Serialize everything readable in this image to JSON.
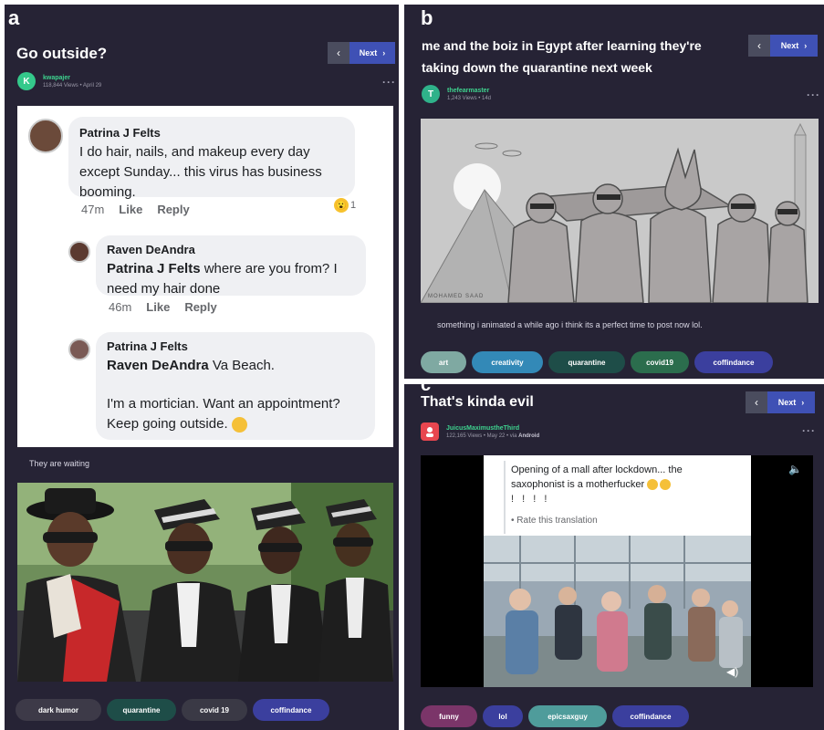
{
  "panels": {
    "a": {
      "letter": "a",
      "title": "Go outside?",
      "nav": {
        "prev": "‹",
        "next": "Next",
        "next_chevron": "›"
      },
      "author": {
        "avatar_letter": "K",
        "username": "kwapajer",
        "stats": "118,844 Views • April 29"
      },
      "more": "···",
      "comments": [
        {
          "name": "Patrina J Felts",
          "lines": [
            "I do hair, nails, and makeup every day",
            "except Sunday... this virus has business",
            "booming."
          ],
          "time": "47m",
          "like": "Like",
          "reply": "Reply",
          "reaction_count": "1"
        },
        {
          "name": "Raven DeAndra",
          "mention": "Patrina J Felts",
          "lines_after_mention": " where are you from? I",
          "line2": "need my hair done",
          "time": "46m",
          "like": "Like",
          "reply": "Reply"
        },
        {
          "name": "Patrina J Felts",
          "mention": "Raven DeAndra",
          "after_mention": " Va Beach.",
          "line2": "I'm a mortician. Want an appointment?",
          "line3": "Keep going outside."
        }
      ],
      "caption": "They are waiting",
      "tags": [
        "dark humor",
        "quarantine",
        "covid 19",
        "coffindance"
      ]
    },
    "b": {
      "letter": "b",
      "title_line1": "me and the boiz in Egypt after learning they're",
      "title_line2": "taking down the quarantine next week",
      "nav": {
        "prev": "‹",
        "next": "Next",
        "next_chevron": "›"
      },
      "author": {
        "avatar_letter": "T",
        "username": "thefearmaster",
        "stats": "1,243 Views • 14d"
      },
      "more": "···",
      "caption": "something i animated a while ago i think its a perfect time to post now lol.",
      "watermark": "MOHAMED SAAD",
      "tags": [
        "art",
        "creativity",
        "quarantine",
        "covid19",
        "coffindance"
      ]
    },
    "c": {
      "letter": "c",
      "title": "That's kinda evil",
      "nav": {
        "prev": "‹",
        "next": "Next",
        "next_chevron": "›"
      },
      "author": {
        "username": "JuicusMaximustheThird",
        "stats_prefix": "122,165 Views • May 22 • via ",
        "stats_platform": "Android"
      },
      "more": "···",
      "video": {
        "text_line1": "Opening of a mall after lockdown... the",
        "text_line2": "saxophonist is a motherfucker",
        "dots": "! ! ! !",
        "translate": "• Rate this translation",
        "mute_icon": "🔈"
      },
      "tags": [
        "funny",
        "lol",
        "epicsaxguy",
        "coffindance"
      ]
    }
  },
  "colors": {
    "panel_bg": "#262335",
    "next_button": "#3f51b5",
    "username_green": "#3ed38f",
    "tag_dark": "#3d3a48",
    "tag_teal": "#1e4d48",
    "tag_purple": "#3b3f9e",
    "tag_blue": "#3389b7",
    "tag_green": "#2b6d4d",
    "tag_pink": "#7b3569"
  }
}
